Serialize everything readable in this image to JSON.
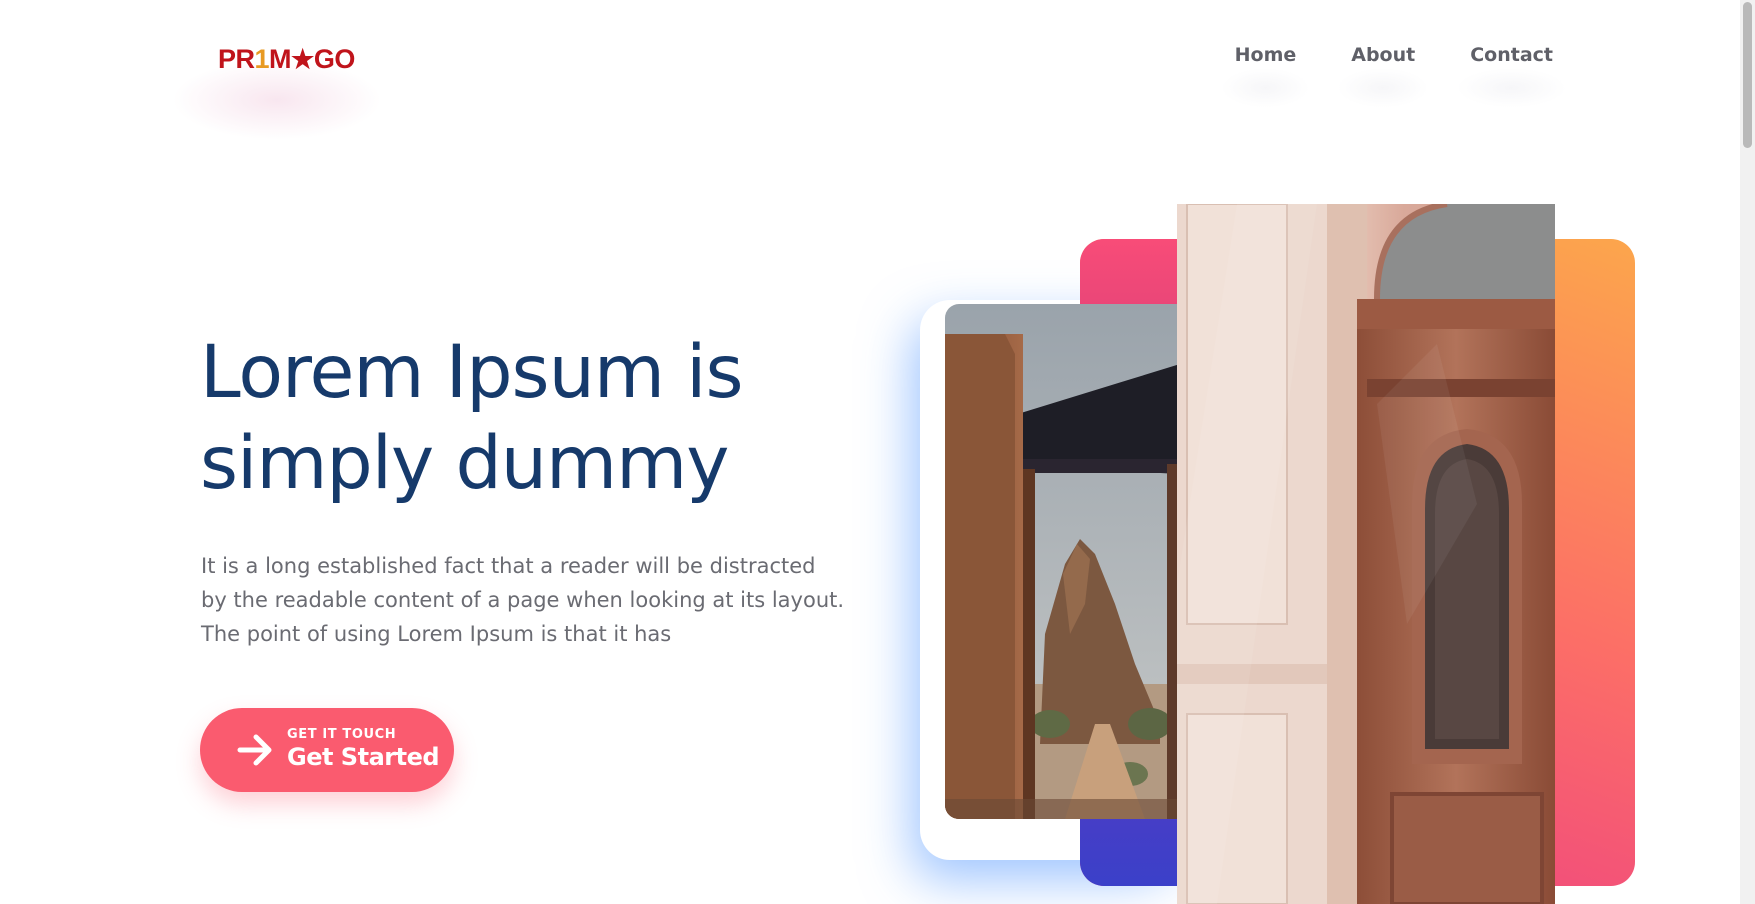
{
  "header": {
    "logo": {
      "part1": "PR",
      "part2": "1",
      "part3": "M",
      "part4": "★",
      "part5": "GO"
    },
    "nav": [
      {
        "label": "Home"
      },
      {
        "label": "About"
      },
      {
        "label": "Contact"
      }
    ]
  },
  "hero": {
    "headline_line1": "Lorem Ipsum is",
    "headline_line2": "simply dummy",
    "description_line1": "It is a long established fact that a reader will be distracted",
    "description_line2": "by the readable content of a page when looking at its layout.",
    "description_line3": "The point of using Lorem Ipsum is that it has",
    "cta": {
      "small_label": "GET IT TOUCH",
      "label": "Get Started",
      "icon": "arrow-right-icon"
    }
  },
  "colors": {
    "brand_red": "#c0141b",
    "headline": "#163a6b",
    "cta": "#fa5b6f",
    "gradient_orange": "#fca64c",
    "gradient_pink": "#ec3d85",
    "gradient_blue": "#3b40c9"
  }
}
